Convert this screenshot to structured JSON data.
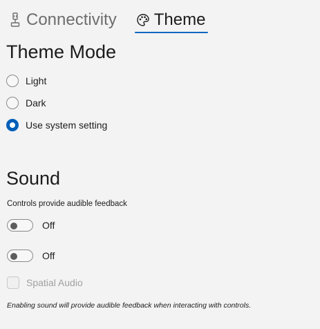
{
  "tabs": [
    {
      "label": "Connectivity",
      "icon": "connectivity-icon"
    },
    {
      "label": "Theme",
      "icon": "palette-icon"
    }
  ],
  "active_tab": "Theme",
  "theme": {
    "title": "Theme Mode",
    "options": [
      {
        "label": "Light",
        "checked": false
      },
      {
        "label": "Dark",
        "checked": false
      },
      {
        "label": "Use system setting",
        "checked": true
      }
    ]
  },
  "sound": {
    "title": "Sound",
    "caption": "Controls provide audible feedback",
    "toggle1": {
      "state": "Off"
    },
    "toggle2": {
      "state": "Off"
    },
    "spatial_audio": {
      "label": "Spatial Audio",
      "checked": false,
      "enabled": false
    },
    "footnote": "Enabling sound will provide audible feedback when interacting with controls."
  },
  "colors": {
    "accent": "#005fb8",
    "background": "#f3f3f3"
  }
}
